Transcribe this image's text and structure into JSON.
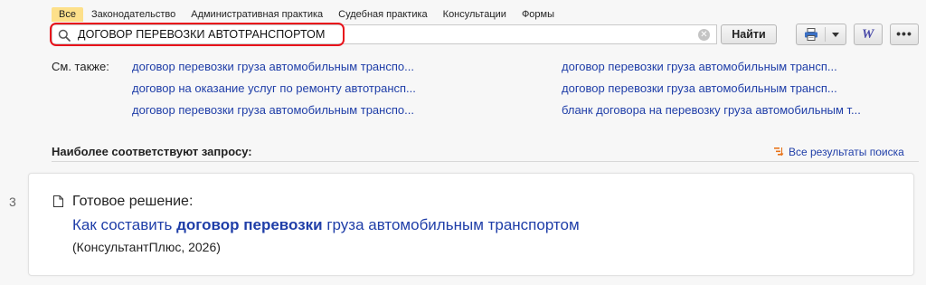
{
  "tabs": [
    {
      "label": "Все",
      "active": true
    },
    {
      "label": "Законодательство",
      "active": false
    },
    {
      "label": "Административная практика",
      "active": false
    },
    {
      "label": "Судебная практика",
      "active": false
    },
    {
      "label": "Консультации",
      "active": false
    },
    {
      "label": "Формы",
      "active": false
    }
  ],
  "search": {
    "value": "ДОГОВОР ПЕРЕВОЗКИ АВТОТРАНСПОРТОМ",
    "icon": "search-icon",
    "clear_icon": "clear-icon",
    "button_label": "Найти",
    "highlight_color": "#e8131b"
  },
  "toolbar": {
    "print_icon": "printer-icon",
    "dropdown_icon": "caret-down-icon",
    "word_icon_label": "W",
    "more_label": "•••"
  },
  "see_also": {
    "label": "См. также:",
    "links": [
      "договор перевозки груза автомобильным транспо...",
      "договор перевозки груза автомобильным трансп...",
      "договор на оказание услуг по ремонту автотрансп...",
      "договор перевозки груза автомобильным трансп...",
      "договор перевозки груза автомобильным транспо...",
      "бланк договора на перевозку груза автомобильным т..."
    ]
  },
  "results": {
    "heading": "Наиболее соответствуют запросу:",
    "all_results_label": "Все результаты поиска",
    "items": [
      {
        "number": "3",
        "type": "Готовое решение:",
        "title_prefix": "Как составить ",
        "title_bold": "договор перевозки",
        "title_suffix": " груза автомобильным транспортом",
        "source": "(КонсультантПлюс, 2026)"
      }
    ]
  },
  "colors": {
    "link": "#1f3ea8",
    "active_tab": "#fde08a",
    "background": "#f7f7f7"
  }
}
